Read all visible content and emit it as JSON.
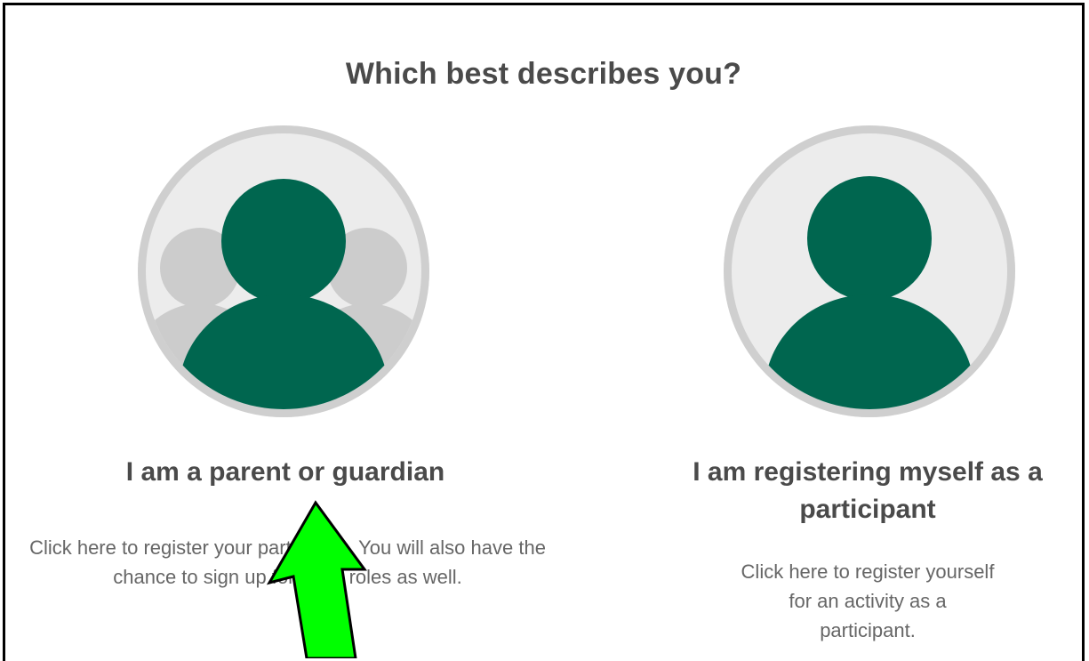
{
  "page": {
    "heading": "Which best describes you?"
  },
  "options": [
    {
      "title": "I am a parent or guardian",
      "description": "Click here to register your participant. You will also have the chance to sign up for team roles as well.",
      "icon": "family-icon"
    },
    {
      "title": "I am registering myself as a participant",
      "description": "Click here to register yourself for an activity as a participant.",
      "icon": "person-icon"
    }
  ],
  "colors": {
    "accent": "#00664f",
    "avatar_bg": "#ececec",
    "avatar_ring": "#cfcfcf",
    "ghost": "#cccccc",
    "annotation_arrow": "#00ff00"
  }
}
